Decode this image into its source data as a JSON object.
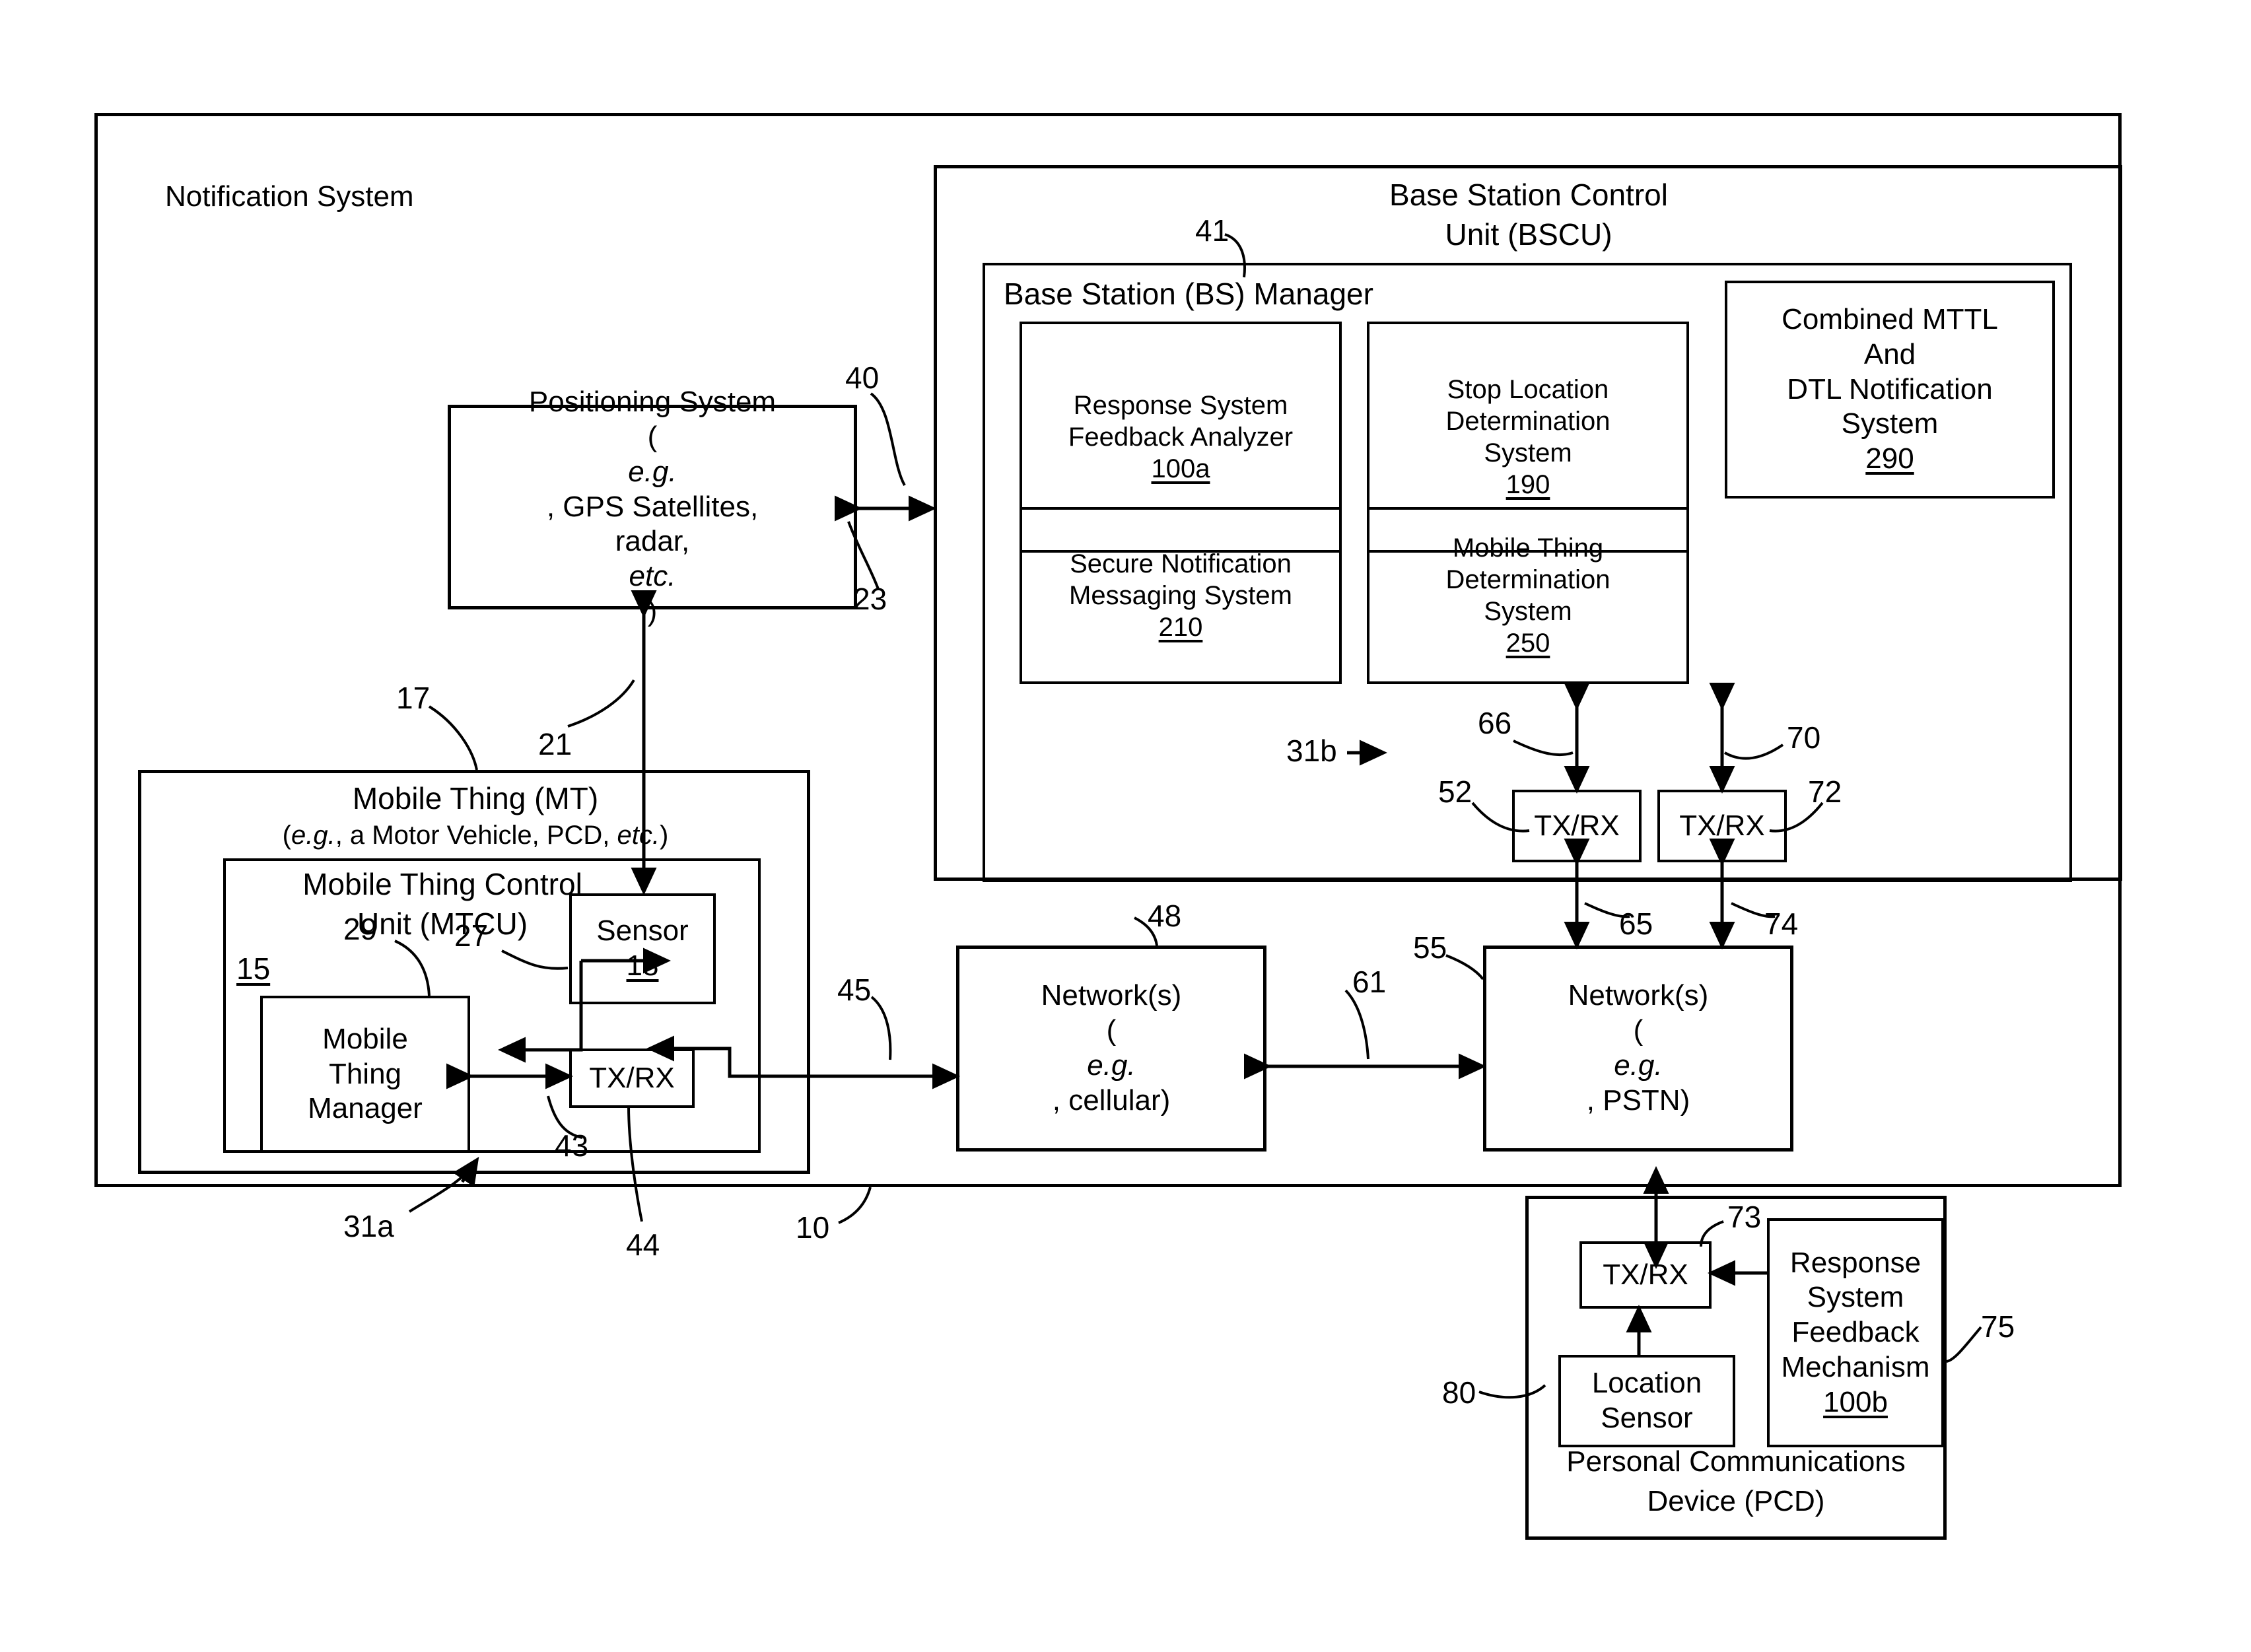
{
  "figure": {
    "outer_label": "Notification System",
    "outer_ref": "10"
  },
  "bscu": {
    "title_line1": "Base Station Control",
    "title_line2": "Unit (BSCU)",
    "ref": "40",
    "manager": {
      "title": "Base Station (BS) Manager",
      "ref": "41",
      "modules": [
        {
          "name_line1": "Response System",
          "name_line2": "Feedback Analyzer",
          "number": "100a"
        },
        {
          "name_line1": "Stop Location",
          "name_line2": "Determination",
          "name_line3": "System",
          "number": "190"
        },
        {
          "name_line1": "Secure Notification",
          "name_line2": "Messaging System",
          "number": "210"
        },
        {
          "name_line1": "Mobile Thing",
          "name_line2": "Determination",
          "name_line3": "System",
          "number": "250"
        },
        {
          "name_line1": "Combined MTTL",
          "name_line2": "And",
          "name_line3": "DTL Notification",
          "name_line4": "System",
          "number": "290"
        }
      ]
    },
    "txrx_left": {
      "label": "TX/RX",
      "ref": "52"
    },
    "txrx_right": {
      "label": "TX/RX",
      "ref": "72"
    },
    "link_66": "66",
    "link_70": "70",
    "link_31b": "31b",
    "link_65": "65",
    "link_74": "74"
  },
  "positioning": {
    "line1": "Positioning System",
    "line2_pre": "(",
    "line2_it": "e.g.",
    "line2_post": ", GPS Satellites,",
    "line3_pre": "radar, ",
    "line3_it": "etc.",
    "line3_post": ")",
    "ref_23": "23",
    "ref_21": "21"
  },
  "mobile_thing": {
    "title": "Mobile Thing (MT)",
    "subtitle_pre": "(",
    "subtitle_it1": "e.g.",
    "subtitle_mid": ", a Motor Vehicle, PCD, ",
    "subtitle_it2": "etc.",
    "subtitle_post": ")",
    "ref": "17",
    "mtcu": {
      "title_line1": "Mobile Thing Control",
      "title_line2": "Unit (MTCU)",
      "number": "15",
      "manager": {
        "line1": "Mobile",
        "line2": "Thing",
        "line3": "Manager",
        "ref": "29"
      },
      "sensor": {
        "label": "Sensor",
        "number": "18",
        "ref": "27"
      },
      "txrx": {
        "label": "TX/RX",
        "ref": "43"
      }
    },
    "ref_31a": "31a",
    "ref_44": "44"
  },
  "networks": {
    "cellular": {
      "line1": "Network(s)",
      "line2_pre": "(",
      "line2_it": "e.g.",
      "line2_post": ", cellular)",
      "ref": "48"
    },
    "pstn": {
      "line1": "Network(s)",
      "line2_pre": "(",
      "line2_it": "e.g.",
      "line2_post": ", PSTN)",
      "ref": "55"
    },
    "link_45": "45",
    "link_61": "61"
  },
  "pcd": {
    "title_line1": "Personal Communications",
    "title_line2": "Device (PCD)",
    "ref": "75",
    "txrx": {
      "label": "TX/RX",
      "ref": "73"
    },
    "location_sensor": {
      "line1": "Location",
      "line2": "Sensor",
      "ref": "80"
    },
    "feedback": {
      "line1": "Response",
      "line2": "System",
      "line3": "Feedback",
      "line4": "Mechanism",
      "number": "100b"
    }
  }
}
